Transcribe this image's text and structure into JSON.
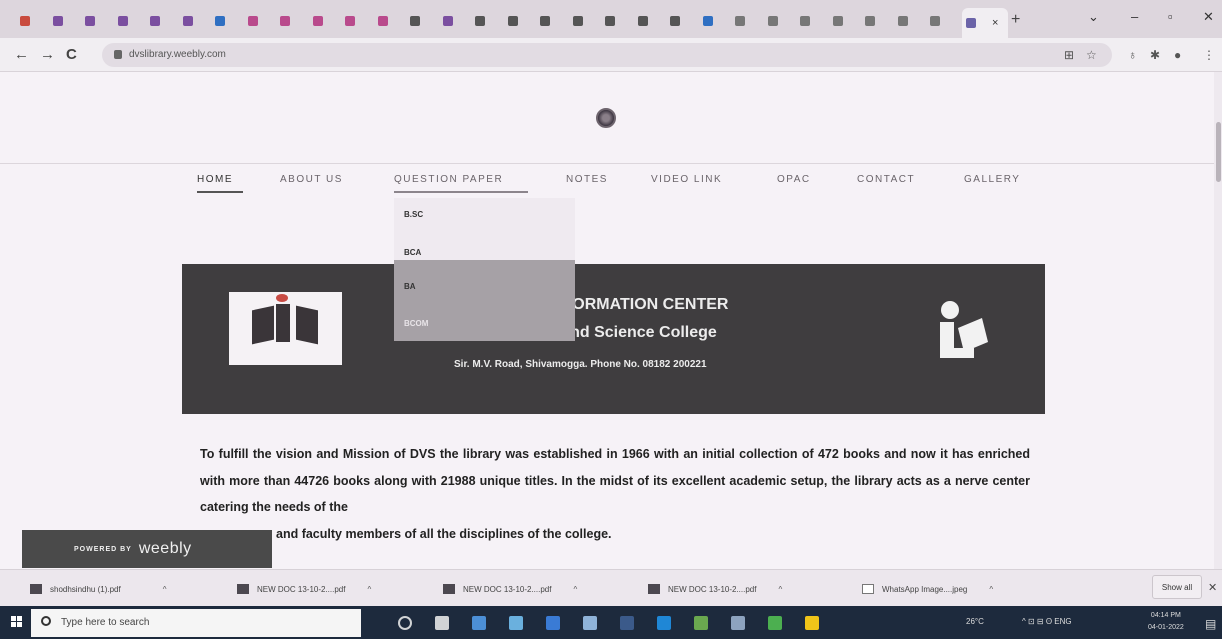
{
  "browser": {
    "url": "dvslibrary.weebly.com",
    "new_tab": "+",
    "close_tab": "×",
    "window_controls": {
      "min": "–",
      "max": "▫",
      "close": "✕",
      "dropdown": "⌄"
    },
    "nav": {
      "back": "←",
      "forward": "→",
      "reload": "C"
    },
    "extensions": [
      "⊞",
      "☆",
      "♁",
      "✱",
      "●",
      "⋮"
    ]
  },
  "site": {
    "nav": [
      {
        "label": "HOME"
      },
      {
        "label": "ABOUT US"
      },
      {
        "label": "QUESTION PAPER"
      },
      {
        "label": "NOTES"
      },
      {
        "label": "VIDEO LINK"
      },
      {
        "label": "OPAC"
      },
      {
        "label": "CONTACT"
      },
      {
        "label": "GALLERY"
      }
    ],
    "dropdown": [
      "B.SC",
      "BCA",
      "BA",
      "BCOM"
    ],
    "banner": {
      "title": "DVS LIBRARY AND INFORMATION CENTER",
      "college": "DVS Arts and Science College",
      "address": "Sir. M.V. Road, Shivamogga. Phone No. 08182 200221"
    },
    "body": "To fulfill the vision and Mission of DVS the library was established in 1966 with an initial collection of 472 books and now it has enriched with more than 44726 books along with 21988 unique titles. In the midst of its excellent academic setup, the library acts as a nerve center catering the needs of the",
    "body_tail": "and faculty members of all the disciplines of the college.",
    "powered_by": "POWERED BY",
    "brand": "weebly"
  },
  "downloads": {
    "items": [
      "shodhsindhu (1).pdf",
      "NEW DOC 13-10-2....pdf",
      "NEW DOC 13-10-2....pdf",
      "NEW DOC 13-10-2....pdf",
      "WhatsApp Image....jpeg"
    ],
    "chevron": "^",
    "show_all": "Show all",
    "close": "✕"
  },
  "taskbar": {
    "search_placeholder": "Type here to search",
    "weather": "26°C",
    "tray": "^ ⊡ ⊟ ʘ ENG",
    "time": "04:14 PM",
    "date": "04-01-2022"
  }
}
